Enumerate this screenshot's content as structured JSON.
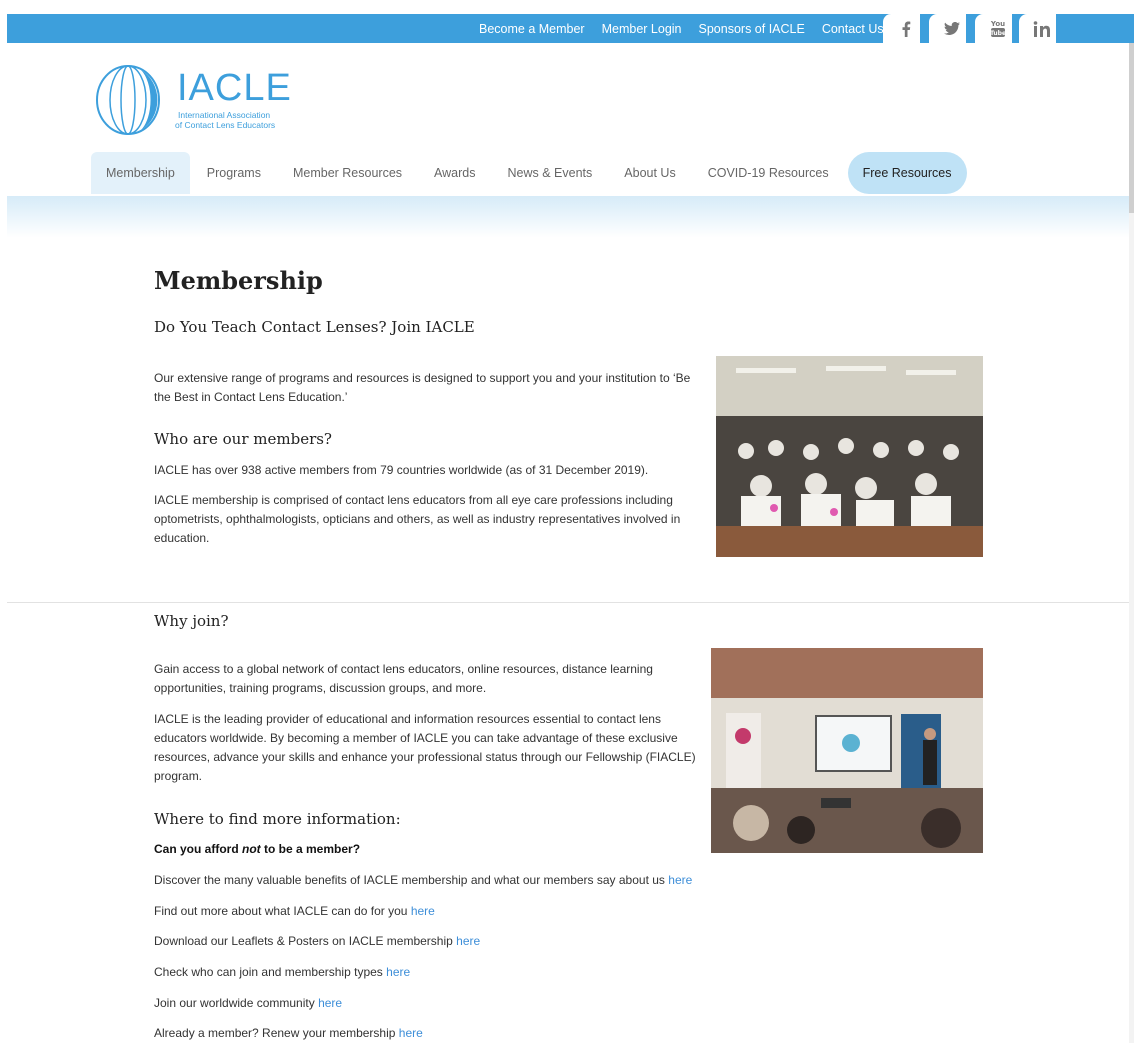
{
  "topbar": {
    "links": [
      "Become a Member",
      "Member Login",
      "Sponsors of IACLE",
      "Contact Us"
    ],
    "social": [
      {
        "name": "facebook-icon",
        "glyph": "f"
      },
      {
        "name": "twitter-icon",
        "glyph": "🐦"
      },
      {
        "name": "youtube-icon",
        "glyph": "You Tube"
      },
      {
        "name": "linkedin-icon",
        "glyph": "in"
      }
    ]
  },
  "logo": {
    "word": "IACLE",
    "line1": "International Association",
    "line2": "of Contact Lens Educators"
  },
  "nav": {
    "items": [
      "Membership",
      "Programs",
      "Member Resources",
      "Awards",
      "News & Events",
      "About Us",
      "COVID-19 Resources",
      "Free Resources"
    ]
  },
  "content": {
    "title": "Membership",
    "subtitle": "Do You Teach Contact Lenses? Join IACLE",
    "intro": "Our extensive range of programs and resources is designed to support you and your institution to ‘Be the Best in Contact Lens Education.’",
    "who_heading": "Who are our members?",
    "who_p1": "IACLE has over 938 active members from 79 countries worldwide (as of 31 December 2019).",
    "who_p2": "IACLE membership is comprised of contact lens educators from all eye care professions including optometrists, ophthalmologists, opticians and others, as well as industry representatives involved in education.",
    "why_heading": "Why join?",
    "why_p1": "Gain access to a global network of contact lens educators, online resources, distance learning opportunities, training programs, discussion groups, and more.",
    "why_p2": "IACLE is the leading provider of educational and information resources essential to contact lens educators worldwide. By becoming a member of IACLE you can take advantage of these exclusive resources, advance your skills and enhance your professional status through our Fellowship (FIACLE) program.",
    "where_heading": "Where to find more information:",
    "afford_pre": "Can you afford ",
    "afford_em": "not",
    "afford_post": " to be a member?",
    "link_text": "here",
    "lines": [
      "Discover the many valuable benefits of IACLE membership and what our members say about us",
      "Find out more about what IACLE can do for you",
      "Download our Leaflets & Posters on IACLE membership",
      "Check who can join and membership types",
      "Join our worldwide community",
      "Already a member? Renew your membership"
    ]
  },
  "colors": {
    "brand": "#3d9fdc",
    "link": "#3d8ed8",
    "pill": "#bfe2f6"
  }
}
